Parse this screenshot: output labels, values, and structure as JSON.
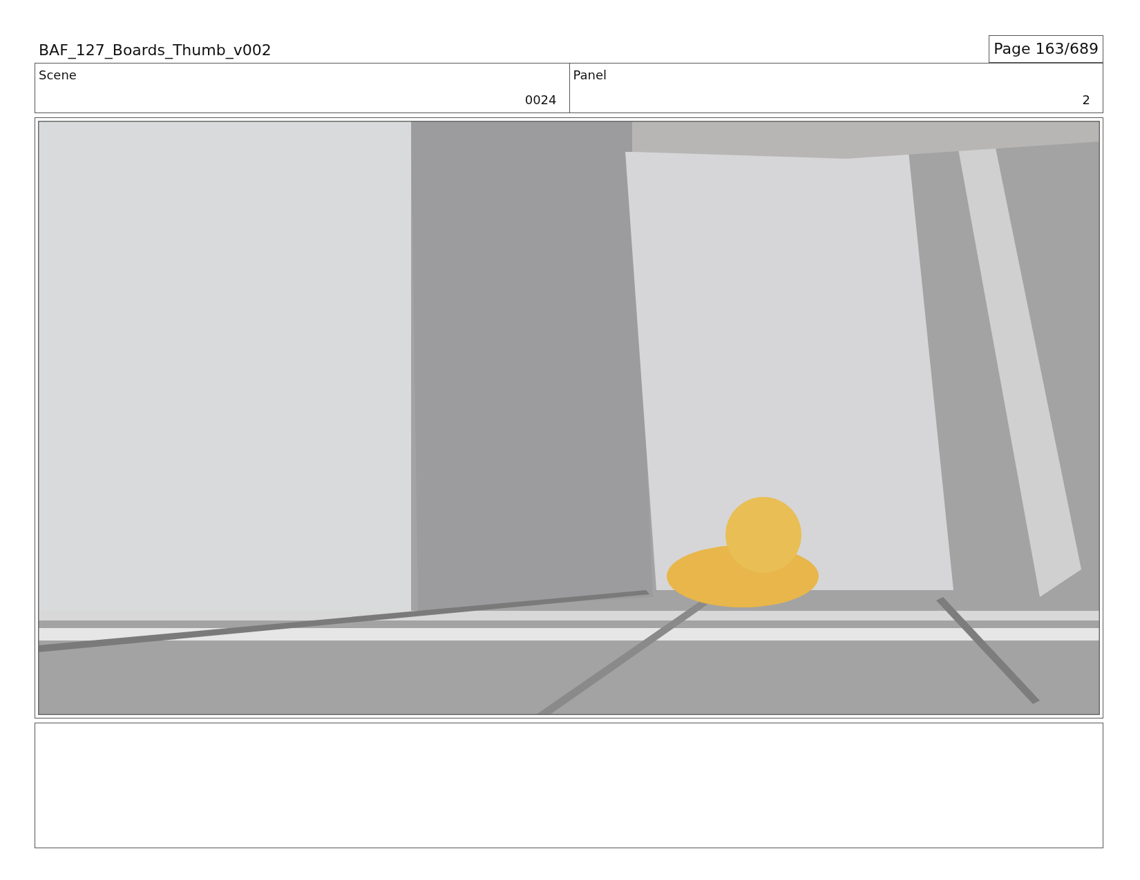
{
  "title": "BAF_127_Boards_Thumb_v002",
  "page": "Page 163/689",
  "fields": [
    {
      "label": "Scene",
      "value": "0024"
    },
    {
      "label": "Panel",
      "value": "2"
    }
  ]
}
